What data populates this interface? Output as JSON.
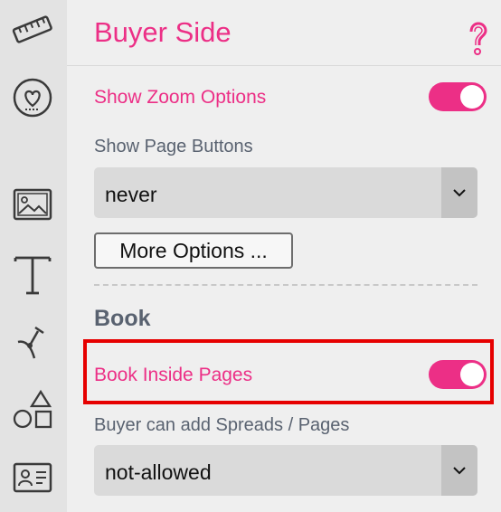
{
  "toolbar": {
    "items": [
      {
        "icon": "ruler-icon"
      },
      {
        "icon": "heart-badge-icon"
      },
      {
        "icon": "image-icon"
      },
      {
        "icon": "text-icon"
      },
      {
        "icon": "curve-path-icon"
      },
      {
        "icon": "shapes-icon"
      },
      {
        "icon": "id-card-icon"
      }
    ]
  },
  "header": {
    "title": "Buyer Side",
    "help_glyph": "?"
  },
  "settings": {
    "show_zoom": {
      "label": "Show Zoom Options",
      "enabled": true
    },
    "page_buttons": {
      "label": "Show Page Buttons",
      "selected": "never"
    },
    "more_options_label": "More Options ...",
    "book_section_title": "Book",
    "book_inside_pages": {
      "label": "Book Inside Pages",
      "enabled": true
    },
    "spreads": {
      "label": "Buyer can add Spreads / Pages",
      "selected": "not-allowed"
    }
  },
  "colors": {
    "accent": "#ec2f86",
    "highlight_border": "#e60000",
    "toolbar_bg": "#e3e3e3",
    "panel_bg": "#efefef"
  }
}
